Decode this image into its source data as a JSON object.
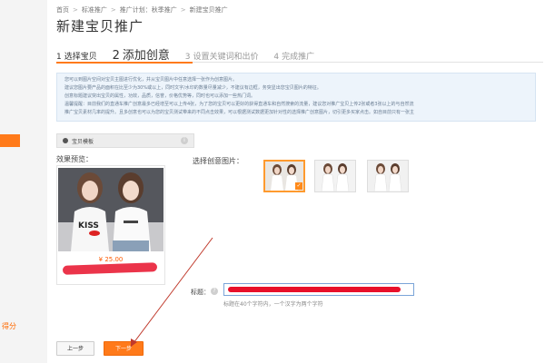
{
  "breadcrumb": {
    "home": "首页",
    "standard": "标准推广",
    "plan": "推广计划：秋季推广",
    "current": "新建宝贝推广"
  },
  "page_title": "新建宝贝推广",
  "steps": [
    {
      "num": "1",
      "label": "选择宝贝"
    },
    {
      "num": "2",
      "label": "添加创意"
    },
    {
      "num": "3",
      "label": "设置关键词和出价"
    },
    {
      "num": "4",
      "label": "完成推广"
    }
  ],
  "tips": [
    "您可以到图片空间对宝贝主图进行优化，并从宝贝图片中任意选择一张作为创意图片。",
    "建议您图片要产品的面积在比至少为30%或以上，同时文字/水印的数量尽量减少，不建议有边框，务突显出您宝贝图片的特征。",
    "创意标题建议突出宝贝的属性，功效，品质，信誉，价格优势等，同时也可以添加一些热门词。",
    "温馨提醒：目前我们的直通车推广创意最多已经增至可以上传4张，为了您的宝贝可以更好的获得直通车和自然搜索的流量，建议您对推广宝贝上传2张或者3张以上的与自然流",
    "推广宝贝素材几率的提升。且多创意也可以为您的宝贝测试带来的不同点击效果，可以根据测试数据更加针对性的选择推广创意图片，切引更多买家点击。如自目前只有一张主"
  ],
  "template_tab": {
    "label": "宝贝模板",
    "info": "i"
  },
  "preview": {
    "label": "效果预览：",
    "price": "¥ 25.00"
  },
  "select_label": "选择创意图片：",
  "thumb_check": "✓",
  "title_field": {
    "label": "标题：",
    "help": "?",
    "hint": "标题在40个字符内，一个汉字为两个字符"
  },
  "buttons": {
    "prev": "上一步",
    "next": "下一步"
  },
  "sidebar": {
    "bottom_text": "得分"
  },
  "colors": {
    "accent": "#ff7a1a",
    "tip_bg": "#edf4fb",
    "redaction": "#e8102a",
    "input_border": "#7aa4d8"
  }
}
